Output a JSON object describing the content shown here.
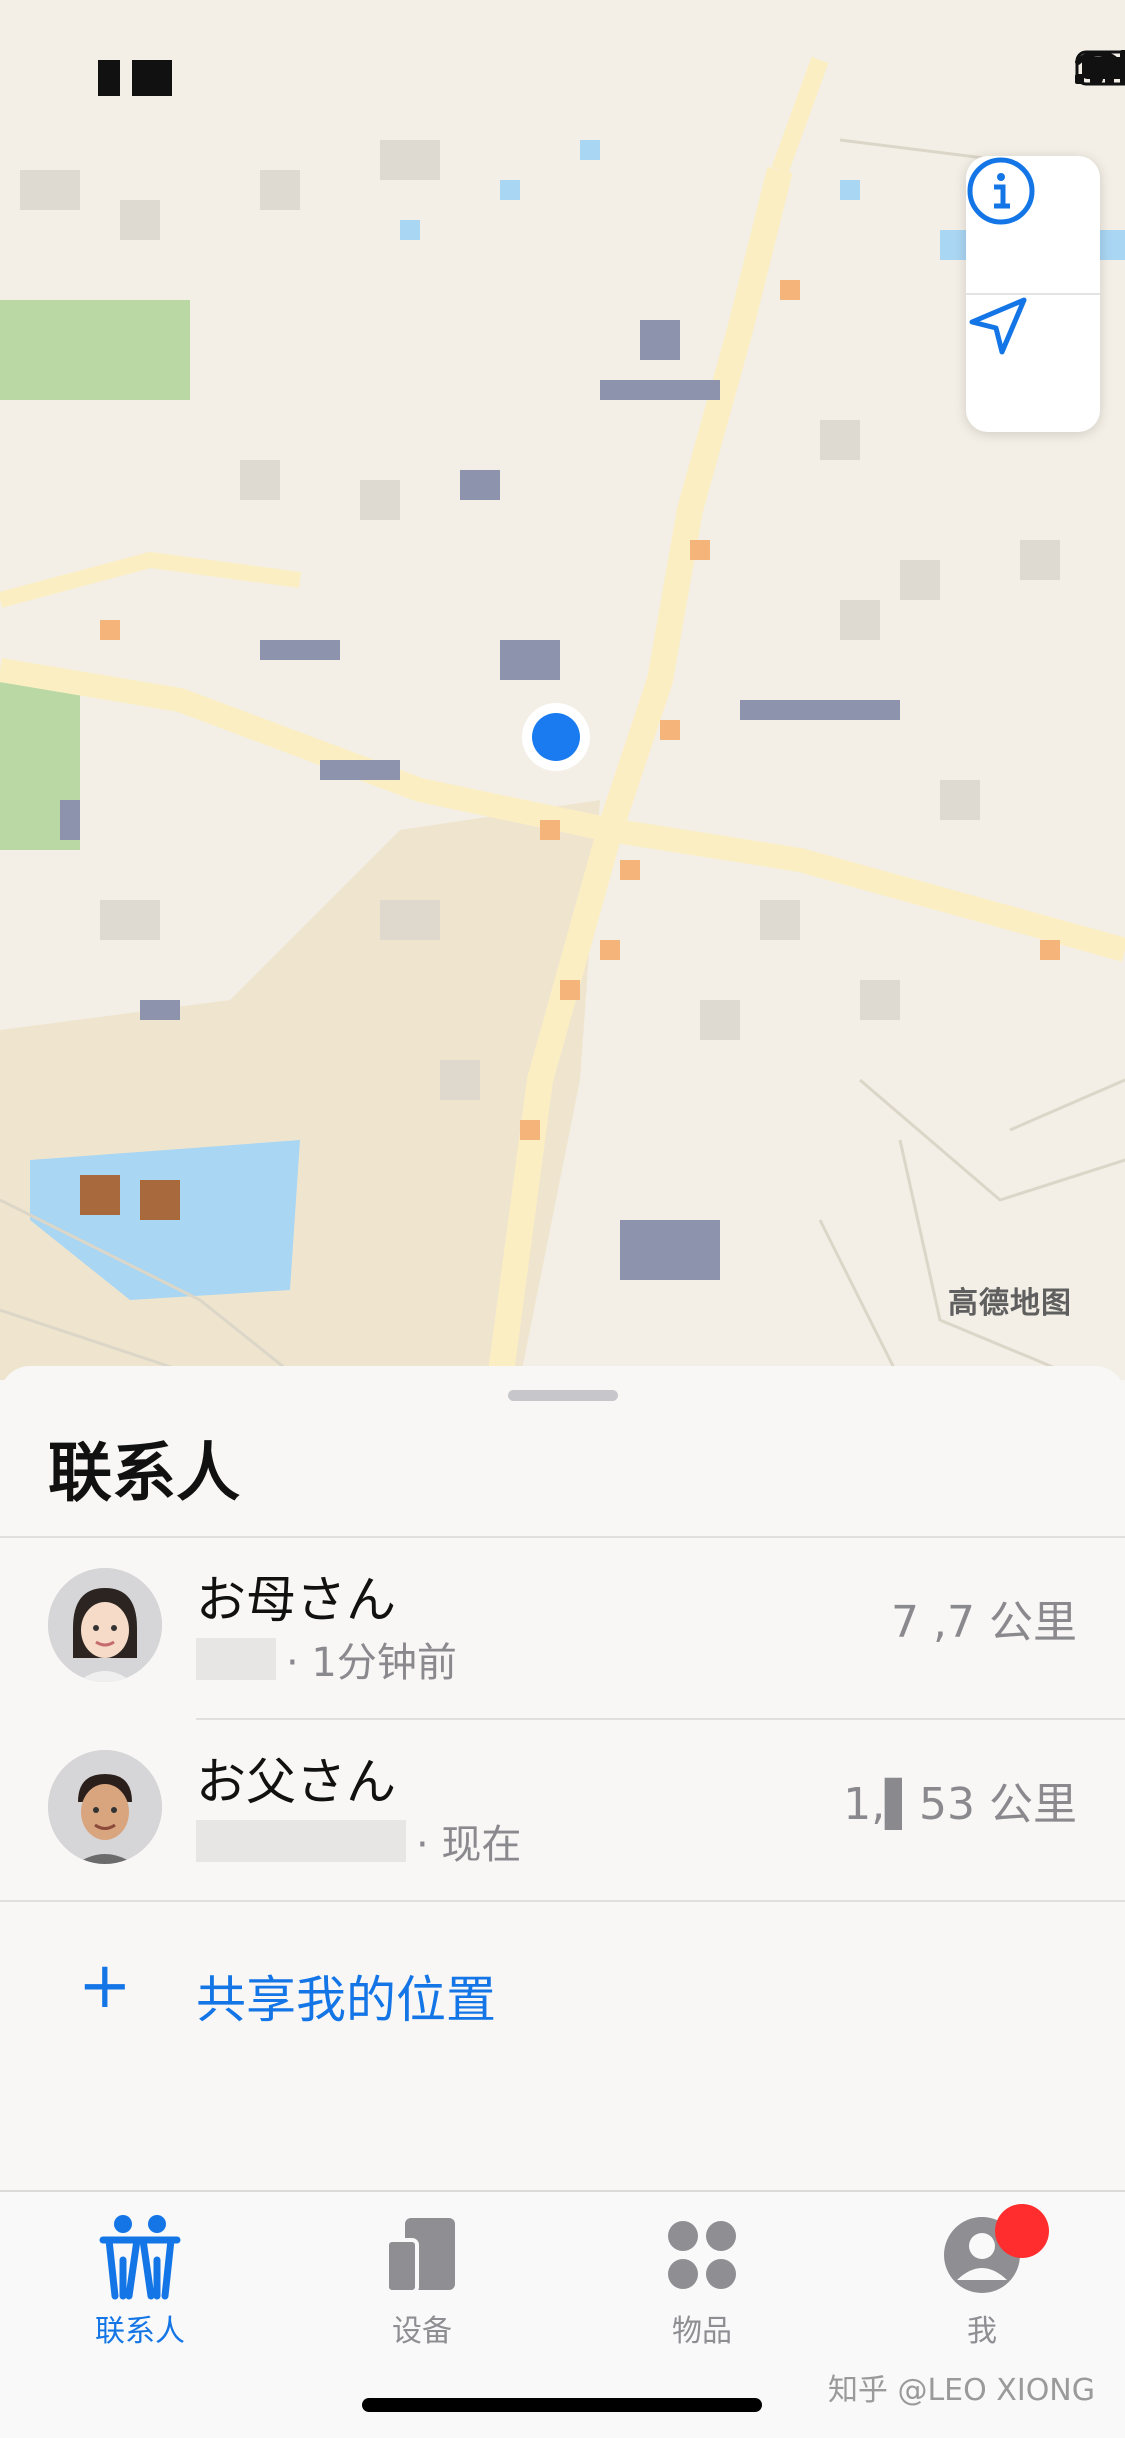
{
  "map": {
    "attribution": "高德地图",
    "icons": {
      "info": "info-circle-icon",
      "locate": "location-arrow-icon",
      "user_location": "blue-dot-icon"
    },
    "colors": {
      "land": "#f3efe6",
      "road": "#fbeec3",
      "road_accent": "#f5b57a",
      "park": "#b9d8a3",
      "water": "#a9d6f3",
      "user": "#1a7bf0"
    }
  },
  "sheet": {
    "title": "联系人",
    "contacts": [
      {
        "name": "お母さん",
        "status": "· 1分钟前",
        "distance": "7 ,7 公里",
        "avatar_icon": "memoji-woman-avatar"
      },
      {
        "name": "お父さん",
        "status": "· 现在",
        "distance": "1,▌53 公里",
        "avatar_icon": "memoji-man-avatar"
      }
    ],
    "share_action": {
      "icon": "plus-icon",
      "label": "共享我的位置"
    }
  },
  "tabbar": {
    "tabs": [
      {
        "label": "联系人",
        "icon": "people-icon",
        "active": true
      },
      {
        "label": "设备",
        "icon": "devices-icon",
        "active": false
      },
      {
        "label": "物品",
        "icon": "items-icon",
        "active": false
      },
      {
        "label": "我",
        "icon": "me-icon",
        "active": false,
        "badge": true
      }
    ],
    "accent": "#1476e6",
    "inactive": "#8e8e93"
  },
  "watermark": "知乎 @LEO XIONG"
}
